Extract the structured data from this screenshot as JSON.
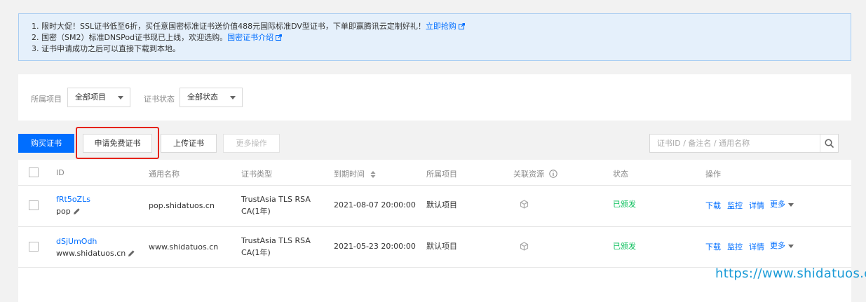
{
  "notice": {
    "line1_text": "1. 限时大促！SSL证书低至6折，买任意国密标准证书送价值488元国际标准DV型证书，下单即赢腾讯云定制好礼！",
    "line1_link": "立即抢购",
    "line2_text": "2. 国密（SM2）标准DNSPod证书现已上线，欢迎选购。",
    "line2_link": "国密证书介绍",
    "line3_text": "3. 证书申请成功之后可以直接下载到本地。"
  },
  "filters": {
    "project_label": "所属项目",
    "project_value": "全部项目",
    "status_label": "证书状态",
    "status_value": "全部状态"
  },
  "toolbar": {
    "buy_label": "购买证书",
    "apply_free_label": "申请免费证书",
    "upload_label": "上传证书",
    "more_label": "更多操作",
    "search_placeholder": "证书ID / 备注名 / 通用名称"
  },
  "table": {
    "headers": {
      "id": "ID",
      "common_name": "通用名称",
      "cert_type": "证书类型",
      "expiry": "到期时间",
      "project": "所属项目",
      "resources": "关联资源",
      "status": "状态",
      "actions": "操作"
    },
    "rows": [
      {
        "id": "fRt5oZLs",
        "remark": "pop",
        "common_name": "pop.shidatuos.cn",
        "cert_type_line1": "TrustAsia TLS RSA",
        "cert_type_line2": "CA(1年)",
        "expiry": "2021-08-07 20:00:00",
        "project": "默认项目",
        "status": "已颁发"
      },
      {
        "id": "dSjUmOdh",
        "remark": "www.shidatuos.cn",
        "common_name": "www.shidatuos.cn",
        "cert_type_line1": "TrustAsia TLS RSA",
        "cert_type_line2": "CA(1年)",
        "expiry": "2021-05-23 20:00:00",
        "project": "默认项目",
        "status": "已颁发"
      }
    ],
    "actions": {
      "download": "下载",
      "monitor": "监控",
      "details": "详情",
      "more": "更多"
    }
  },
  "watermark": "https://www.shidatuos.cn",
  "colors": {
    "primary": "#006eff",
    "success": "#0abf5b",
    "highlight": "#e5231a",
    "notice_bg": "#e5f0fb"
  }
}
